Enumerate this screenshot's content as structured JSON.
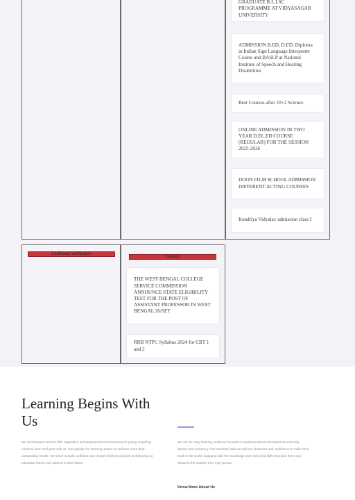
{
  "top_cards": [
    "GRADUATE B.L.I.SC PROGRAMME AT VIDYASAGAR UNIVERSITY",
    "ADMISSION B.ED, D.ED, Diploma in Indian Sign Language Interpreter Course and BASLP at National Institute of Speech and Hearing Disabilities",
    "Best Courses after 10+2 Science",
    "ONLINE ADMISSION IN TWO YEAR D.EL.ED COURSE (REGULAR) FOR THE SESSION 2025-2026",
    "DOON FILM SCHOOL ADMISSION DIFFERENT ACTING COURSES",
    "Kendriya Vidyalay admission class I"
  ],
  "verification_header": "Certificate Verification",
  "syllabus_header": "Syllabus",
  "syllabus_cards": [
    "THE WEST BENGAL COLLEGE SERVICE COMMISSION ANNOUNCE STATE ELIGIBILITY TEST FOR THE POST OF ASSISTANT PROFESSOR IN WEST BENGAL 26/SET",
    "RRB NTPC Syllabus 2024 for CBT 1 and 2"
  ],
  "about": {
    "title": "Learning Begins With Us",
    "left_text": "We at Champion School offer supportive and inspirational environments for young enquiring minds to learn and grow with us. Our passion for learning means we achieve more than outstanding results. We strive to build confident and creative thinkers and aim at delivering an education that is truly tailored to their future.",
    "right_text": "We are an early learning academy focused on social-emotional development and early literacy and numeracy. Our students walk out with the character and confidence to make their mark in the world, equipped with the knowledge and real-world skills that take them way ahead in the industry they may pursue.",
    "link_label": "Know More About Us",
    "accent_color": "#9a9cd6"
  }
}
